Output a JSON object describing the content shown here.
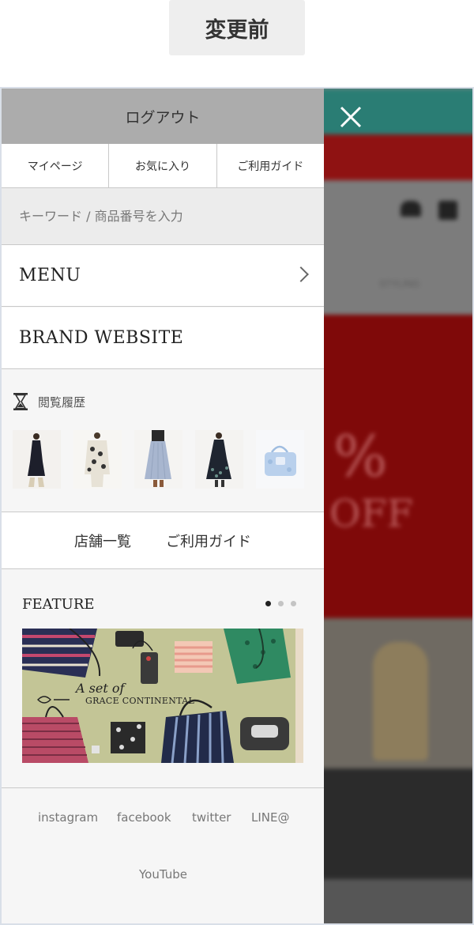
{
  "caption": "変更前",
  "background_page": {
    "banner_percent": "%",
    "banner_off": "OFF",
    "styling_label": "STYLING"
  },
  "drawer": {
    "logout_label": "ログアウト",
    "quick_nav": [
      {
        "label": "マイページ"
      },
      {
        "label": "お気に入り"
      },
      {
        "label": "ご利用ガイド"
      }
    ],
    "search": {
      "placeholder": "キーワード / 商品番号を入力"
    },
    "menu_label": "MENU",
    "brand_website_label": "BRAND WEBSITE",
    "history": {
      "title": "閲覧履歴",
      "items": [
        {
          "name": "black-dress"
        },
        {
          "name": "printed-blouse"
        },
        {
          "name": "pleated-skirt"
        },
        {
          "name": "floral-dress"
        },
        {
          "name": "blue-handbag"
        }
      ]
    },
    "links": [
      {
        "label": "店舗一覧"
      },
      {
        "label": "ご利用ガイド"
      }
    ],
    "feature": {
      "title": "FEATURE",
      "slides": 3,
      "active_slide": 1,
      "banner_text_1": "A set of",
      "banner_text_2": "GRACE CONTINENTAL"
    },
    "social": [
      {
        "label": "instagram"
      },
      {
        "label": "facebook"
      },
      {
        "label": "twitter"
      },
      {
        "label": "LINE@"
      },
      {
        "label": "YouTube"
      }
    ]
  },
  "colors": {
    "teal": "#2a7d74",
    "red": "#8f1212",
    "drawer_bg": "#f6f6f6",
    "logout_bg": "#acacac"
  }
}
